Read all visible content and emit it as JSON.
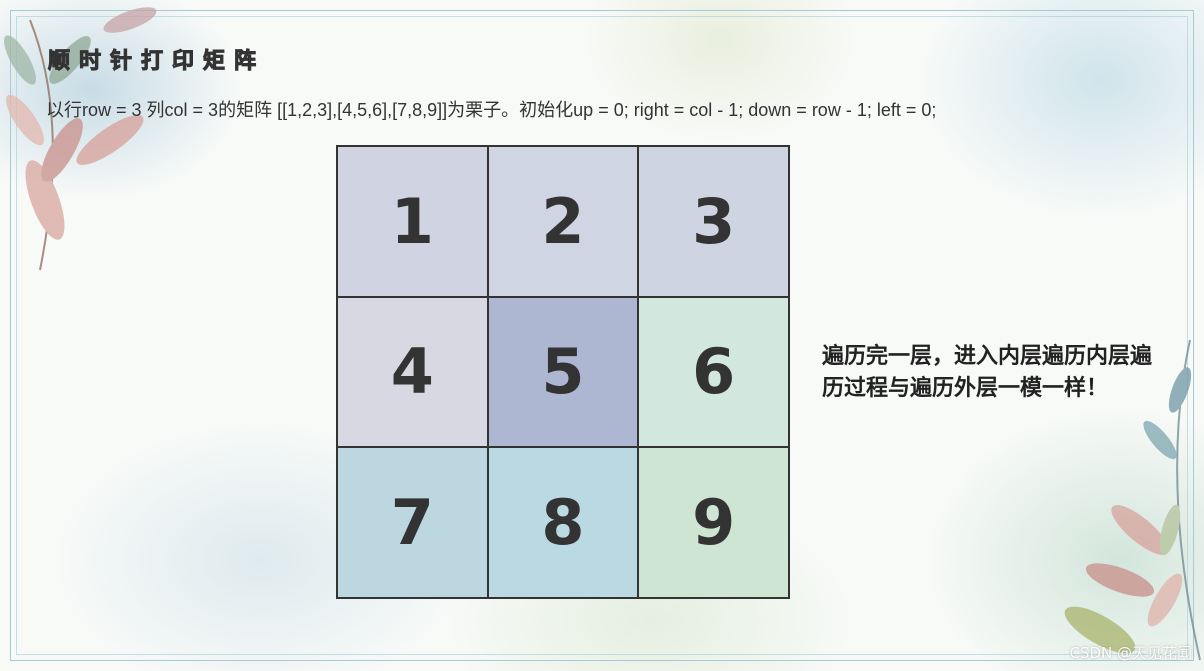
{
  "slide": {
    "title_chars": [
      "顺",
      "时",
      "针",
      "打",
      "印",
      "矩",
      "阵"
    ],
    "subtitle": "以行row = 3 列col = 3的矩阵 [[1,2,3],[4,5,6],[7,8,9]]为栗子。初始化up = 0; right = col - 1; down  = row - 1; left = 0;",
    "note": "遍历完一层，进入内层遍历内层遍历过程与遍历外层一模一样！",
    "watermark": "CSDN @天见花闻"
  },
  "matrix": {
    "cells": [
      {
        "value": "1",
        "color": "#cfd3e2"
      },
      {
        "value": "2",
        "color": "#d0d5e3"
      },
      {
        "value": "3",
        "color": "#cfd4e2"
      },
      {
        "value": "4",
        "color": "#d8d8e2"
      },
      {
        "value": "5",
        "color": "#aeb7d2"
      },
      {
        "value": "6",
        "color": "#d2e7dd"
      },
      {
        "value": "7",
        "color": "#bcd7e0"
      },
      {
        "value": "8",
        "color": "#bbd9e3"
      },
      {
        "value": "9",
        "color": "#cfe5d4"
      }
    ]
  }
}
